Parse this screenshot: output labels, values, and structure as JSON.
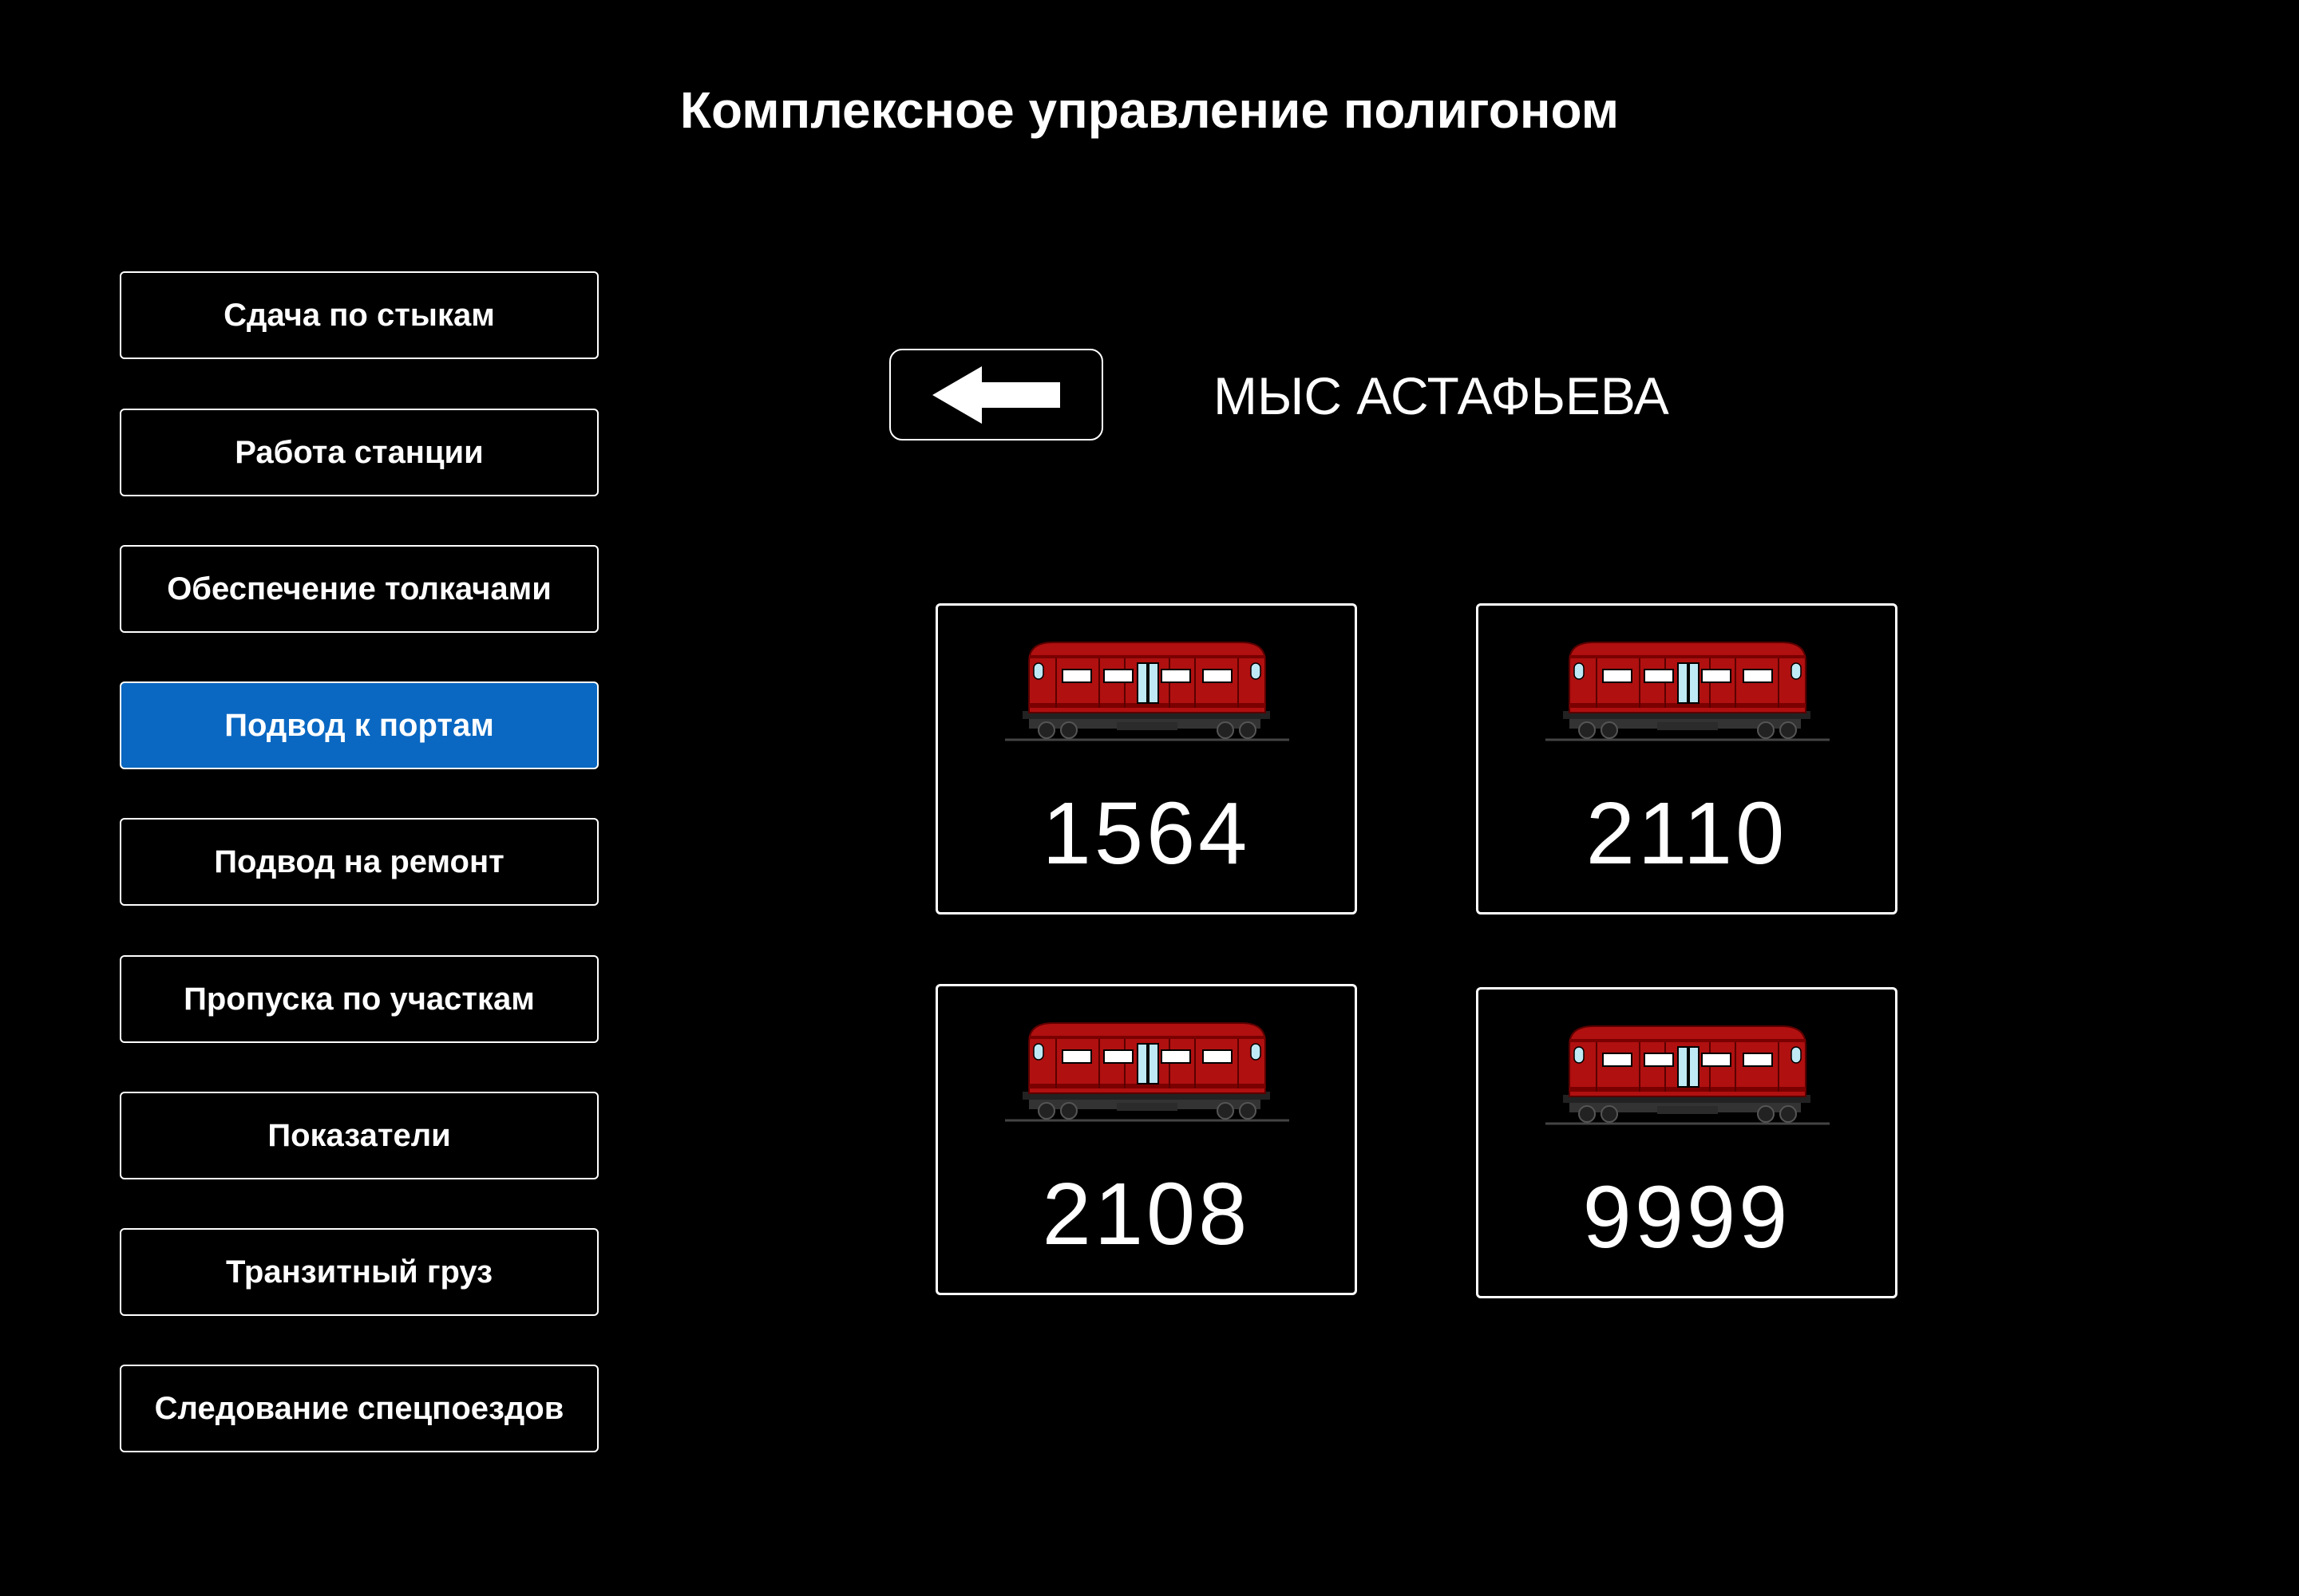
{
  "header": {
    "title": "Комплексное управление полигоном"
  },
  "nav": {
    "items": [
      {
        "label": "Сдача по стыкам"
      },
      {
        "label": "Работа станции"
      },
      {
        "label": "Обеспечение толкачами"
      },
      {
        "label": "Подвод к портам"
      },
      {
        "label": "Подвод на ремонт"
      },
      {
        "label": "Пропуска по участкам"
      },
      {
        "label": "Показатели"
      },
      {
        "label": "Транзитный груз"
      },
      {
        "label": "Следование спецпоездов"
      }
    ],
    "active_index": 3,
    "active_color": "#0a68c2"
  },
  "station": {
    "back_icon": "arrow-left-icon",
    "name": "МЫС АСТАФЬЕВА"
  },
  "trains": [
    {
      "number": "1564",
      "icon": "train-car-icon"
    },
    {
      "number": "2110",
      "icon": "train-car-icon"
    },
    {
      "number": "2108",
      "icon": "train-car-icon"
    },
    {
      "number": "9999",
      "icon": "train-car-icon"
    }
  ],
  "colors": {
    "background": "#000000",
    "text": "#ffffff",
    "train_body": "#b01010"
  }
}
